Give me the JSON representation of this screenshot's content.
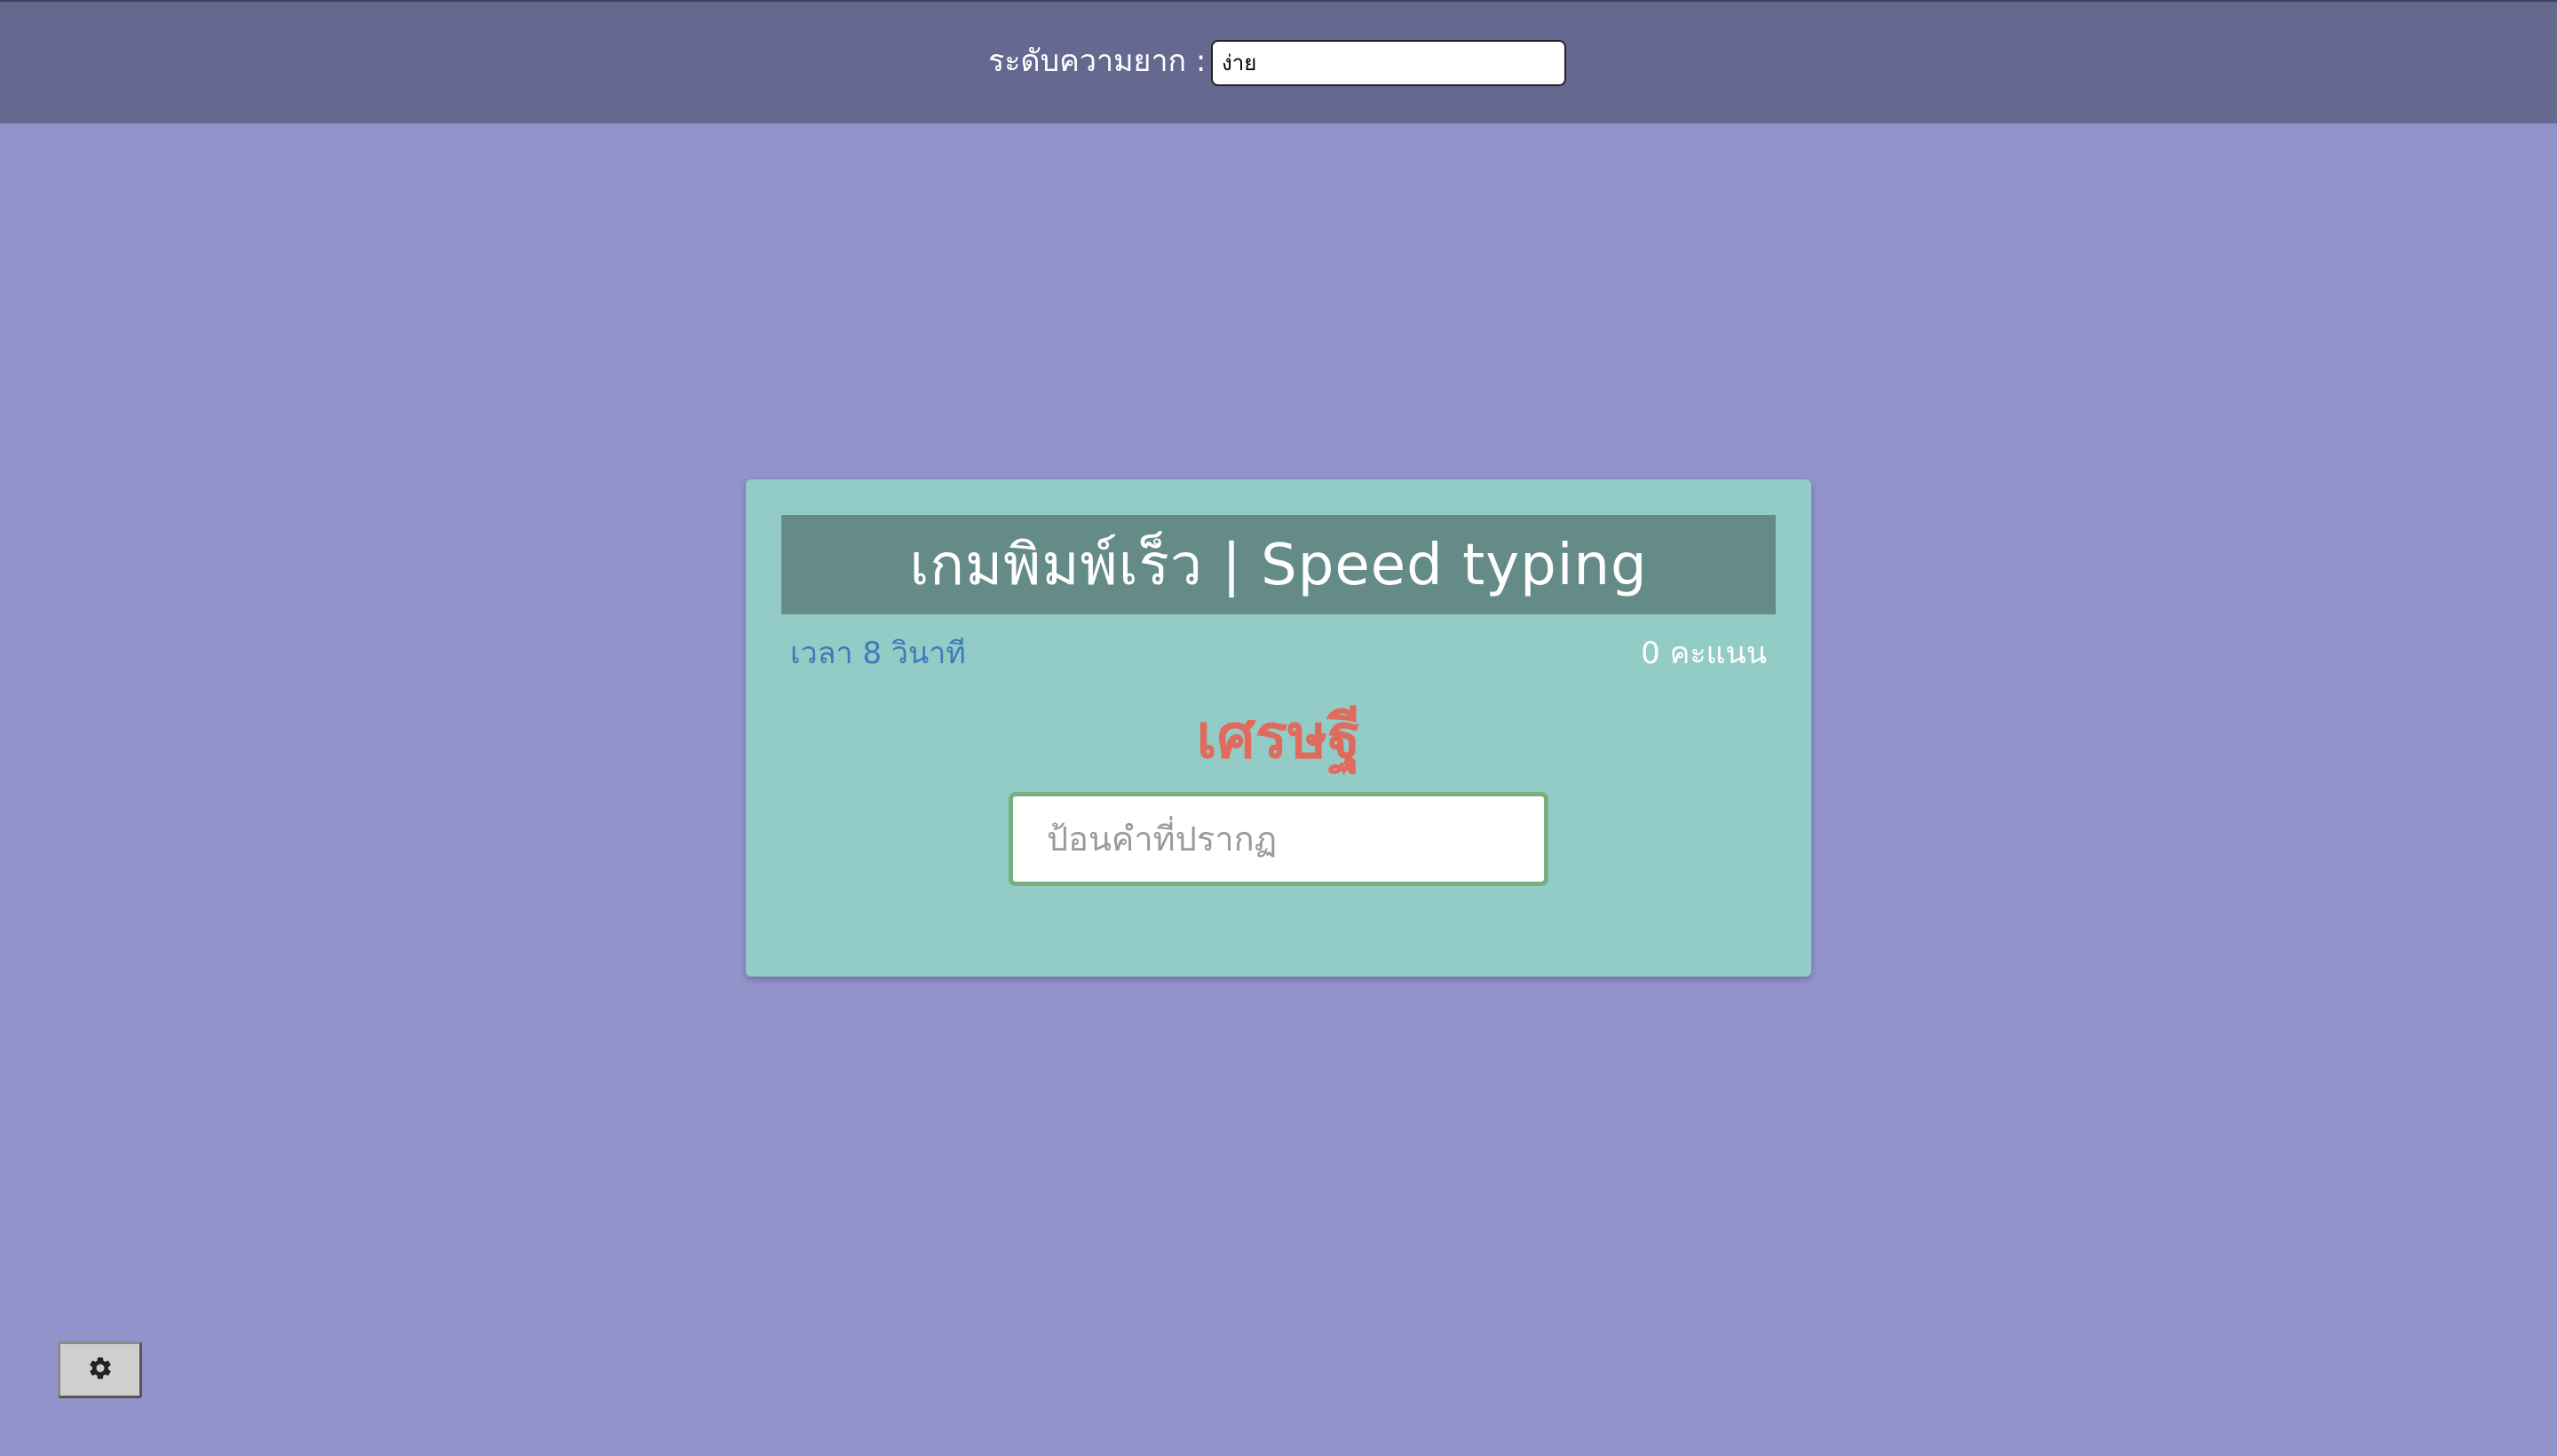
{
  "header": {
    "difficulty_label": "ระดับความยาก :",
    "difficulty_value": "ง่าย"
  },
  "game": {
    "title": "เกมพิมพ์เร็ว | Speed typing",
    "time_text": "เวลา 8 วินาที",
    "score_text": "0 คะแนน",
    "current_word": "เศรษฐี",
    "input_placeholder": "ป้อนคำที่ปรากฏ",
    "input_value": ""
  },
  "footer": {
    "settings_icon": "gear-icon"
  },
  "colors": {
    "background": "#9393cc",
    "topbar": "#65688f",
    "card": "#93cbc7",
    "title_bar": "#648b87",
    "time_text": "#3f7bb7",
    "word": "#e06b5d",
    "input_border": "#78b07d"
  }
}
